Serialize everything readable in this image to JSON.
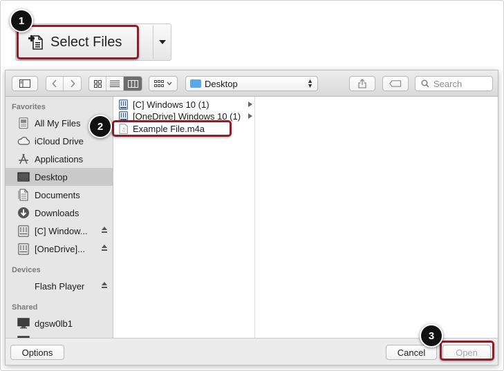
{
  "top": {
    "select_files_label": "Select Files"
  },
  "callouts": [
    "1",
    "2",
    "3"
  ],
  "toolbar": {
    "location": "Desktop",
    "search_placeholder": "Search"
  },
  "sidebar": {
    "favorites_header": "Favorites",
    "favorites": [
      {
        "label": "All My Files",
        "icon": "all-files-icon"
      },
      {
        "label": "iCloud Drive",
        "icon": "cloud-icon"
      },
      {
        "label": "Applications",
        "icon": "applications-icon"
      },
      {
        "label": "Desktop",
        "icon": "desktop-icon",
        "selected": true
      },
      {
        "label": "Documents",
        "icon": "documents-icon"
      },
      {
        "label": "Downloads",
        "icon": "downloads-icon"
      },
      {
        "label": "[C] Window...",
        "icon": "drive-icon",
        "eject": true
      },
      {
        "label": "[OneDrive]...",
        "icon": "drive-icon",
        "eject": true
      }
    ],
    "devices_header": "Devices",
    "devices": [
      {
        "label": "Flash Player",
        "eject": true
      }
    ],
    "shared_header": "Shared",
    "shared": [
      {
        "label": "dgsw0lb1",
        "icon": "computer-icon"
      }
    ]
  },
  "files": [
    {
      "name": "[C] Windows 10 (1)",
      "icon": "network-drive-icon",
      "has_children": true
    },
    {
      "name": "[OneDrive] Windows 10 (1)",
      "icon": "network-drive-icon",
      "has_children": true
    },
    {
      "name": "Example File.m4a",
      "icon": "audio-file-icon",
      "has_children": false
    }
  ],
  "footer": {
    "options_label": "Options",
    "cancel_label": "Cancel",
    "open_label": "Open"
  },
  "colors": {
    "highlight": "#8b1e2a",
    "selected_row": "#c9c9c9",
    "folder_blue": "#5aa8e8"
  }
}
